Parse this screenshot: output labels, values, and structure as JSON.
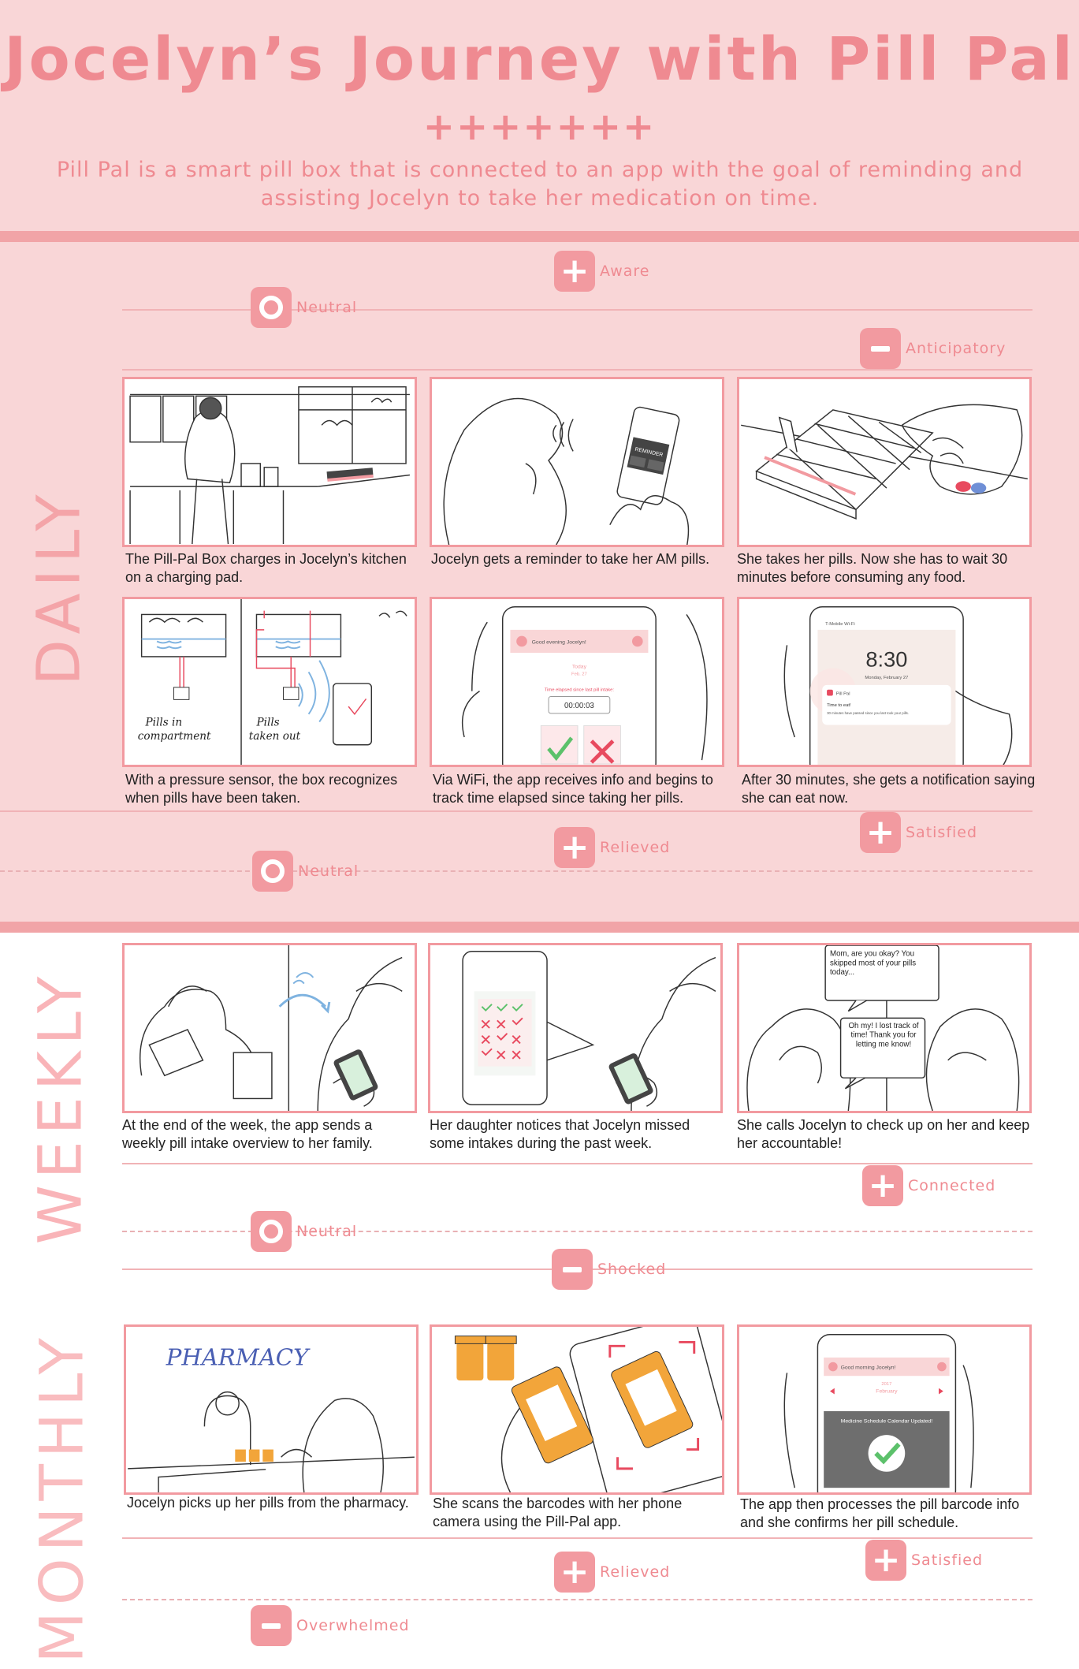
{
  "header": {
    "title": "Jocelyn’s Journey with Pill Pal",
    "plusses": "+++++++",
    "subtitle": "Pill Pal is a smart pill box that is connected to an app with the goal of reminding and assisting Jocelyn to take her medication on time."
  },
  "sections": {
    "daily": "DAILY",
    "weekly": "WEEKLY",
    "monthly": "MONTHLY"
  },
  "emotions": {
    "d_aware": "Aware",
    "d_neutral_top": "Neutral",
    "d_anticipatory": "Anticipatory",
    "d_satisfied": "Satisfied",
    "d_relieved": "Relieved",
    "d_neutral_bottom": "Neutral",
    "w_connected": "Connected",
    "w_neutral": "Neutral",
    "w_shocked": "Shocked",
    "m_relieved": "Relieved",
    "m_satisfied": "Satisfied",
    "m_overwhelmed": "Overwhelmed"
  },
  "captions": {
    "d1": "The Pill-Pal Box charges in Jocelyn’s kitchen on a charging pad.",
    "d2": "Jocelyn gets a reminder to take her AM pills.",
    "d3": "She takes her pills. Now she has to wait 30 minutes before consuming any food.",
    "d4": "With a pressure sensor, the box recognizes when pills have been taken.",
    "d5": "Via WiFi, the app receives info and begins to track time elapsed since taking her pills.",
    "d6": "After 30 minutes, she gets a notification saying she can eat now.",
    "w1": "At the end of the week, the app sends a weekly pill intake overview to her family.",
    "w2": "Her daughter notices that Jocelyn missed some intakes during the past week.",
    "w3": "She calls Jocelyn to check up on her and keep her accountable!",
    "m1": "Jocelyn picks up her pills from the pharmacy.",
    "m2": "She scans the barcodes with her phone camera using the Pill-Pal app.",
    "m3": "The app then processes the pill barcode info and she confirms her pill schedule."
  },
  "panel_text": {
    "reminder": "REMINDER",
    "pills_in": "Pills in",
    "compartment": "compartment",
    "pills": "Pills",
    "taken_out": "taken out",
    "greeting": "Good evening Jocelyn!",
    "today": "Today",
    "date_short": "Feb. 27",
    "elapsed_label": "Time elapsed since last pill intake:",
    "timer": "00:00:03",
    "carrier": "T-Mobile Wi-Fi",
    "clock": "8:30",
    "lock_date": "Monday, February 27",
    "app_name": "Pill Pal",
    "notif_title": "Time to eat!",
    "notif_body": "30 minutes have passed since you last took your pills.",
    "bubble1": "Mom, are you okay? You skipped most of your pills today...",
    "bubble2": "Oh my! I lost track of time! Thank you for letting me know!",
    "pharmacy": "PHARMACY",
    "morning": "Good morning Jocelyn!",
    "year": "2017",
    "month": "February",
    "calendar_msg": "Medicine Schedule Calendar Updated!"
  }
}
